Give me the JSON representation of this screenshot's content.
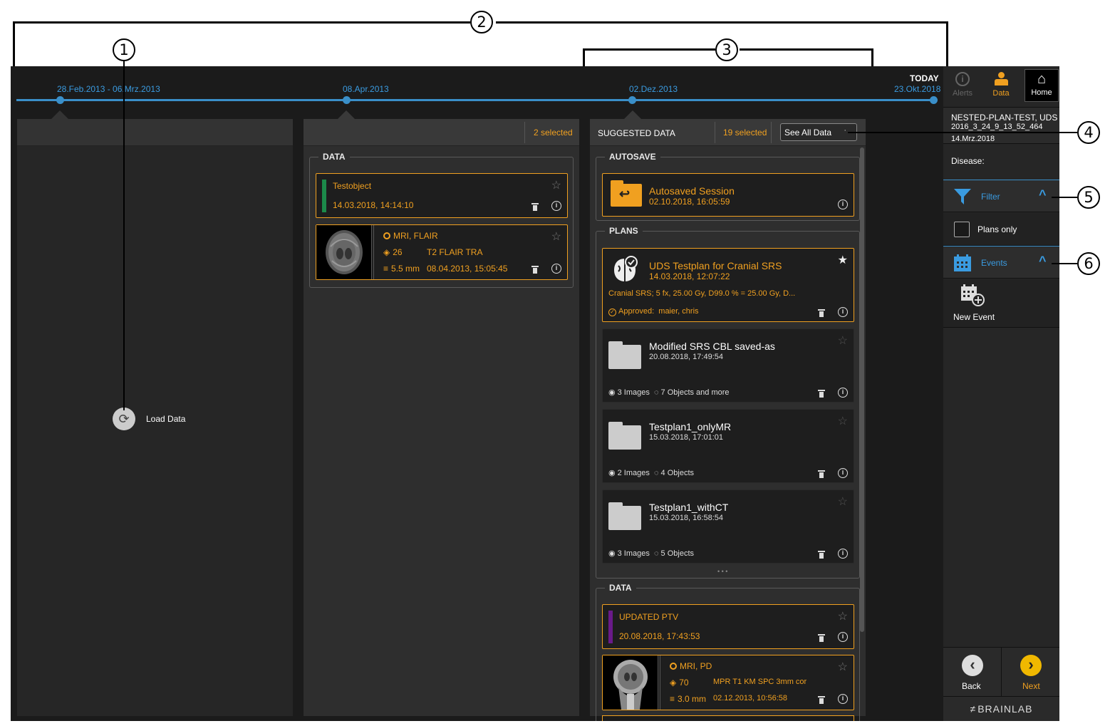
{
  "callouts": [
    "1",
    "2",
    "3",
    "4",
    "5",
    "6"
  ],
  "timeline": {
    "labels": [
      "28.Feb.2013 - 06.Mrz.2013",
      "08.Apr.2013",
      "02.Dez.2013"
    ],
    "today_label": "TODAY",
    "today_date": "23.Okt.2018"
  },
  "col1": {
    "load_label": "Load Data"
  },
  "col2": {
    "selected": "2 selected",
    "data_title": "DATA",
    "item1": {
      "name": "Testobject",
      "date": "14.03.2018, 14:14:10",
      "color": "#1c8a4a"
    },
    "item2": {
      "modality": "MRI, FLAIR",
      "count": "26",
      "series": "T2 FLAIR TRA",
      "thickness": "5.5 mm",
      "date": "08.04.2013, 15:05:45"
    }
  },
  "col3": {
    "title": "SUGGESTED DATA",
    "selected": "19 selected",
    "see_all": "See All Data",
    "autosave_title": "AUTOSAVE",
    "autosave": {
      "name": "Autosaved Session",
      "date": "02.10.2018, 16:05:59"
    },
    "plans_title": "PLANS",
    "plan1": {
      "name": "UDS Testplan for Cranial SRS",
      "date": "14.03.2018, 12:07:22",
      "desc": "Cranial SRS; 5 fx, 25.00 Gy, D99.0 % = 25.00 Gy, D...",
      "approved": "Approved:",
      "approver": "maier, chris"
    },
    "plan2": {
      "name": "Modified SRS CBL saved-as",
      "date": "20.08.2018, 17:49:54",
      "images": "3 Images",
      "objects": "7 Objects and more"
    },
    "plan3": {
      "name": "Testplan1_onlyMR",
      "date": "15.03.2018, 17:01:01",
      "images": "2 Images",
      "objects": "4 Objects"
    },
    "plan4": {
      "name": "Testplan1_withCT",
      "date": "15.03.2018, 16:58:54",
      "images": "3 Images",
      "objects": "5 Objects"
    },
    "more": "• • •",
    "data_title": "DATA",
    "data1": {
      "name": "UPDATED PTV",
      "date": "20.08.2018, 17:43:53",
      "color": "#6a1a8a"
    },
    "data2": {
      "modality": "MRI, PD",
      "count": "70",
      "series": "MPR T1 KM SPC 3mm cor",
      "thickness": "3.0 mm",
      "date": "02.12.2013, 10:56:58"
    }
  },
  "right": {
    "alerts": "Alerts",
    "data": "Data",
    "home": "Home",
    "patient_name": "NESTED-PLAN-TEST, UDS",
    "patient_id": "2016_3_24_9_13_52_464",
    "patient_date": "14.Mrz.2018",
    "disease": "Disease:",
    "filter": "Filter",
    "plans_only": "Plans only",
    "events": "Events",
    "new_event": "New Event",
    "back": "Back",
    "next": "Next",
    "brand": "BRAINLAB"
  },
  "colors": {
    "accent": "#f0a020",
    "blue": "#3a8fc9",
    "bg": "#1b1b1b"
  }
}
